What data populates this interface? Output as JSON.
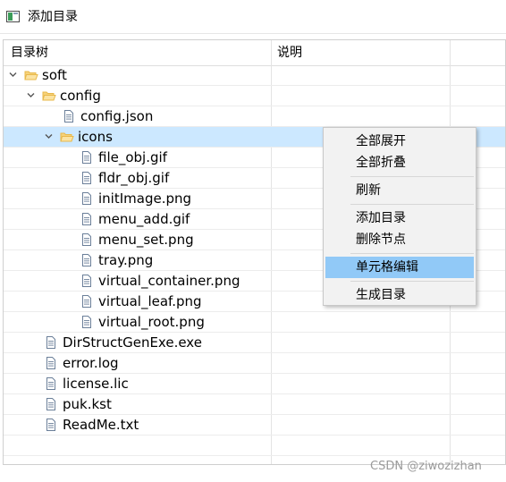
{
  "window": {
    "title": "添加目录"
  },
  "table": {
    "columns": [
      "目录树",
      "说明"
    ],
    "rows": [
      {
        "label": "soft",
        "kind": "folder",
        "expanded": true,
        "depth": 0
      },
      {
        "label": "config",
        "kind": "folder",
        "expanded": true,
        "depth": 1
      },
      {
        "label": "config.json",
        "kind": "file",
        "depth": 2
      },
      {
        "label": "icons",
        "kind": "folder",
        "expanded": true,
        "depth": 2,
        "selected": true
      },
      {
        "label": "file_obj.gif",
        "kind": "file",
        "depth": 3
      },
      {
        "label": "fldr_obj.gif",
        "kind": "file",
        "depth": 3
      },
      {
        "label": "initImage.png",
        "kind": "file",
        "depth": 3
      },
      {
        "label": "menu_add.gif",
        "kind": "file",
        "depth": 3
      },
      {
        "label": "menu_set.png",
        "kind": "file",
        "depth": 3
      },
      {
        "label": "tray.png",
        "kind": "file",
        "depth": 3
      },
      {
        "label": "virtual_container.png",
        "kind": "file",
        "depth": 3
      },
      {
        "label": "virtual_leaf.png",
        "kind": "file",
        "depth": 3
      },
      {
        "label": "virtual_root.png",
        "kind": "file",
        "depth": 3
      },
      {
        "label": "DirStructGenExe.exe",
        "kind": "file",
        "depth": 1
      },
      {
        "label": "error.log",
        "kind": "file",
        "depth": 1
      },
      {
        "label": "license.lic",
        "kind": "file",
        "depth": 1
      },
      {
        "label": "puk.kst",
        "kind": "file",
        "depth": 1
      },
      {
        "label": "ReadMe.txt",
        "kind": "file",
        "depth": 1
      }
    ]
  },
  "context_menu": {
    "items": [
      {
        "label": "全部展开"
      },
      {
        "label": "全部折叠"
      },
      {
        "sep": true
      },
      {
        "label": "刷新"
      },
      {
        "sep": true
      },
      {
        "label": "添加目录"
      },
      {
        "label": "删除节点"
      },
      {
        "sep": true
      },
      {
        "label": "单元格编辑",
        "highlighted": true
      },
      {
        "sep": true
      },
      {
        "label": "生成目录"
      }
    ]
  },
  "watermark": "CSDN @ziwozizhan",
  "colors": {
    "selection": "#cce8ff",
    "menu_highlight": "#91c9f7",
    "folder": "#e8b84a",
    "file_icon_line": "#6b7f99"
  },
  "icons": {
    "folder": "folder-open-icon",
    "file": "file-icon",
    "expanded": "chevron-down-icon",
    "app": "window-app-icon"
  }
}
